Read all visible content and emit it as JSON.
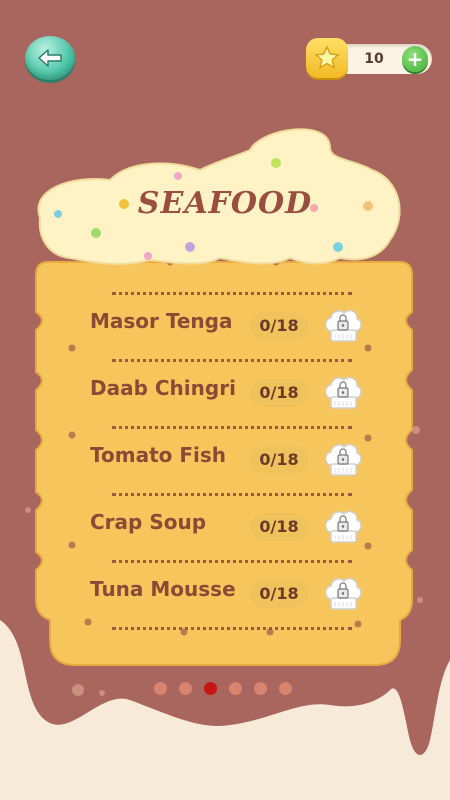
{
  "header": {
    "coin_count": "10",
    "plus_label": "+"
  },
  "category": {
    "title": "SEAFOOD"
  },
  "recipes": [
    {
      "name": "Masor Tenga",
      "progress": "0/18",
      "locked": true
    },
    {
      "name": "Daab Chingri",
      "progress": "0/18",
      "locked": true
    },
    {
      "name": "Tomato Fish",
      "progress": "0/18",
      "locked": true
    },
    {
      "name": "Crap Soup",
      "progress": "0/18",
      "locked": true
    },
    {
      "name": "Tuna Mousse",
      "progress": "0/18",
      "locked": true
    }
  ],
  "pager": {
    "pages": 6,
    "active_index": 2
  },
  "colors": {
    "background": "#a8665e",
    "card": "#f6c65c",
    "cream": "#fff3c6",
    "title": "#9a4e40",
    "active_dot": "#c71414"
  },
  "icons": {
    "back": "back-arrow-icon",
    "coin": "star-coin-icon",
    "plus": "plus-icon",
    "locked_recipe": "chef-hat-lock-icon"
  }
}
